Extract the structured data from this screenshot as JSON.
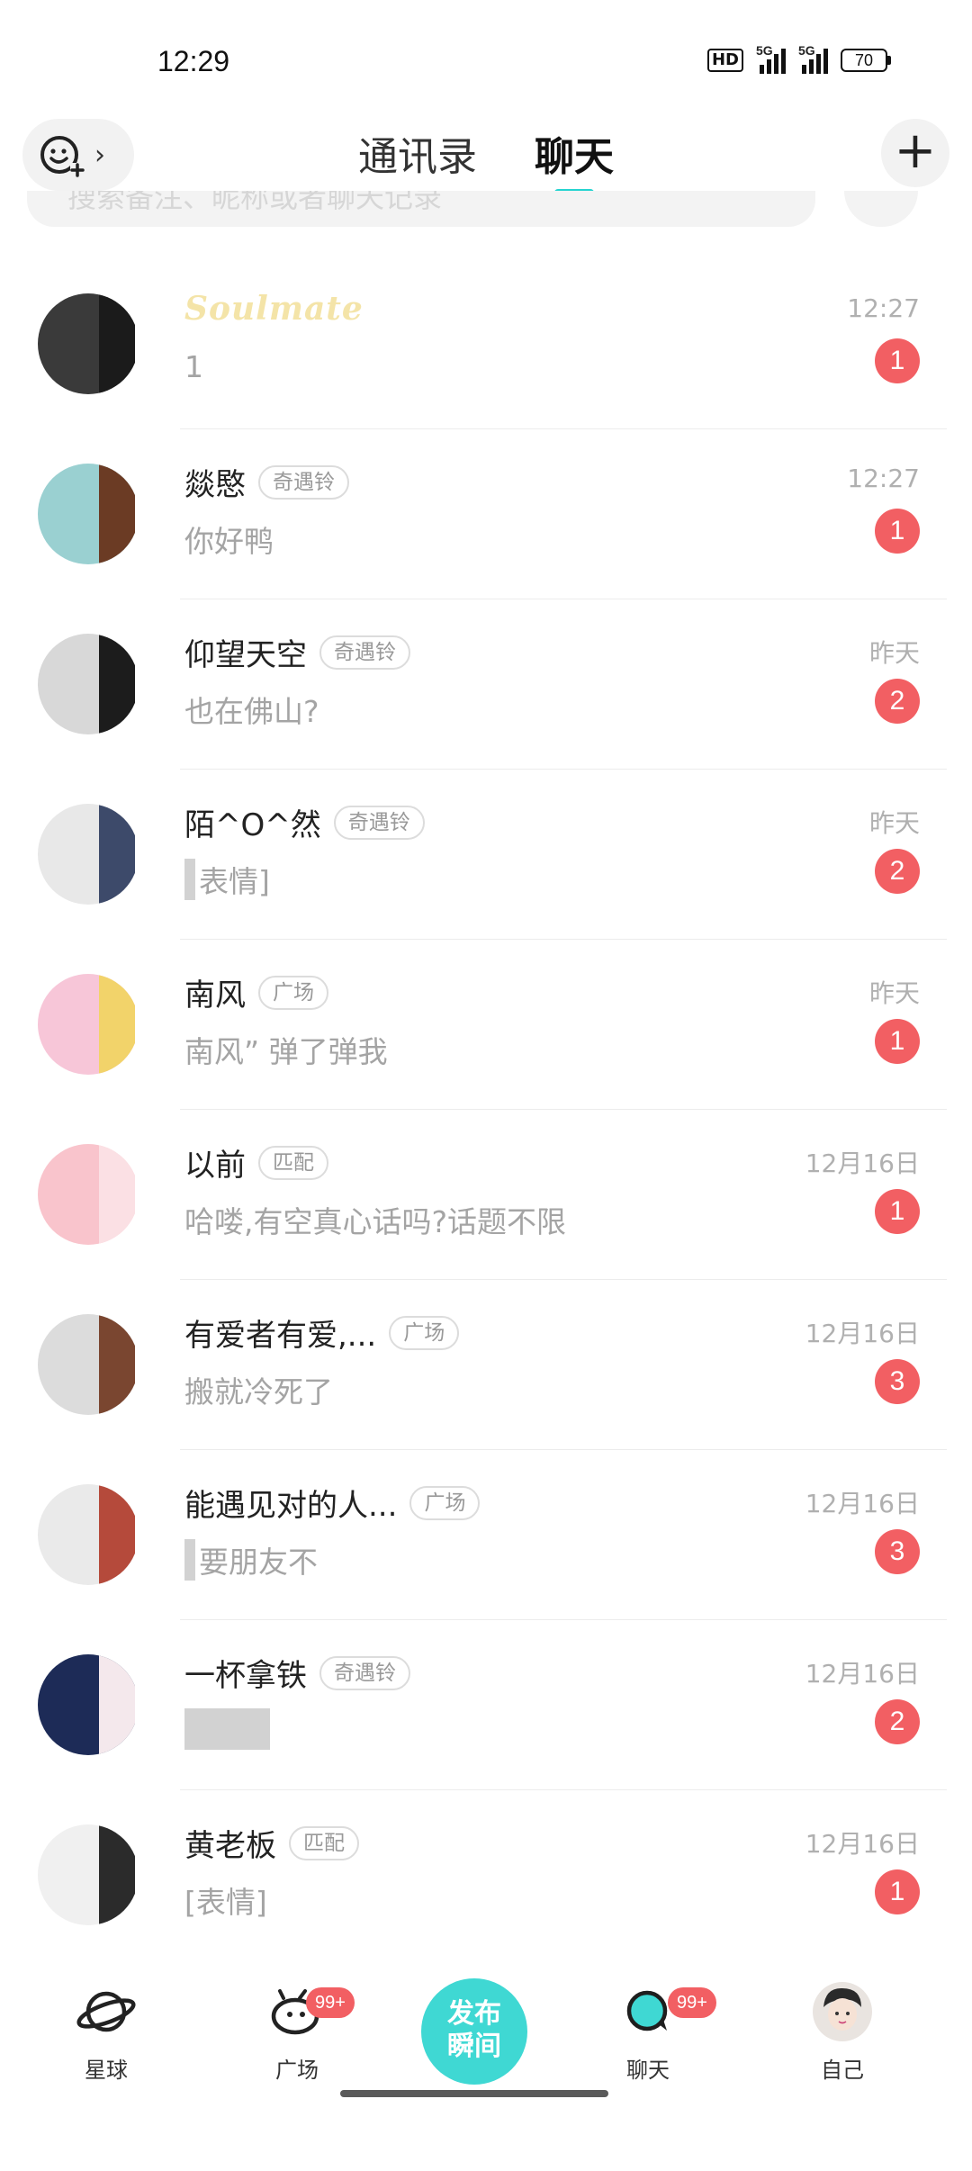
{
  "status_bar": {
    "time": "12:29",
    "hd_label": "HD",
    "signal_label": "5G",
    "battery": "70"
  },
  "header": {
    "tab_contacts": "通讯录",
    "tab_chat": "聊天",
    "plus_label": "+"
  },
  "search": {
    "placeholder": "搜索备注、昵称或者聊天记录"
  },
  "conversations": [
    {
      "name": "",
      "name_extra": "Soulmate",
      "tag": "",
      "preview": "1",
      "time": "12:27",
      "unread": "1",
      "avatar_colors": [
        "#3a3a3a",
        "#1b1b1b"
      ]
    },
    {
      "name": "燚愍",
      "tag": "奇遇铃",
      "preview": "你好鸭",
      "time": "12:27",
      "unread": "1",
      "avatar_colors": [
        "#9ad0d1",
        "#6b3b24"
      ]
    },
    {
      "name": "仰望天空",
      "tag": "奇遇铃",
      "preview": "也在佛山?",
      "time": "昨天",
      "unread": "2",
      "avatar_colors": [
        "#d8d8d8",
        "#1c1c1c"
      ]
    },
    {
      "name": "陌^O^然",
      "tag": "奇遇铃",
      "preview": "表情]",
      "time": "昨天",
      "unread": "2",
      "avatar_colors": [
        "#e8e8e8",
        "#3d4a6a"
      ]
    },
    {
      "name": "南风",
      "tag": "广场",
      "preview": "南风” 弹了弹我",
      "time": "昨天",
      "unread": "1",
      "avatar_colors": [
        "#f7c6d8",
        "#f2d36a"
      ]
    },
    {
      "name": "以前",
      "tag": "匹配",
      "preview": "哈喽,有空真心话吗?话题不限",
      "time": "12月16日",
      "unread": "1",
      "avatar_colors": [
        "#f9c4cc",
        "#fbe0e4"
      ]
    },
    {
      "name": "有爱者有爱,...",
      "tag": "广场",
      "preview": "搬就冷死了",
      "time": "12月16日",
      "unread": "3",
      "avatar_colors": [
        "#dcdcdc",
        "#7a4630"
      ]
    },
    {
      "name": "能遇见对的人...",
      "tag": "广场",
      "preview": "要朋友不",
      "time": "12月16日",
      "unread": "3",
      "avatar_colors": [
        "#eaeaea",
        "#b54a3b"
      ]
    },
    {
      "name": "一杯拿铁",
      "tag": "奇遇铃",
      "preview": "",
      "time": "12月16日",
      "unread": "2",
      "avatar_colors": [
        "#1d2b57",
        "#f4e8ec"
      ]
    },
    {
      "name": "黄老板",
      "tag": "匹配",
      "preview": "[表情]",
      "time": "12月16日",
      "unread": "1",
      "avatar_colors": [
        "#f0f0f0",
        "#2b2b2b"
      ]
    }
  ],
  "nav": {
    "planet": "星球",
    "square": "广场",
    "square_badge": "99+",
    "publish": "发布瞬间",
    "chat": "聊天",
    "chat_badge": "99+",
    "me": "自己",
    "accent_color": "#26c3c2"
  }
}
